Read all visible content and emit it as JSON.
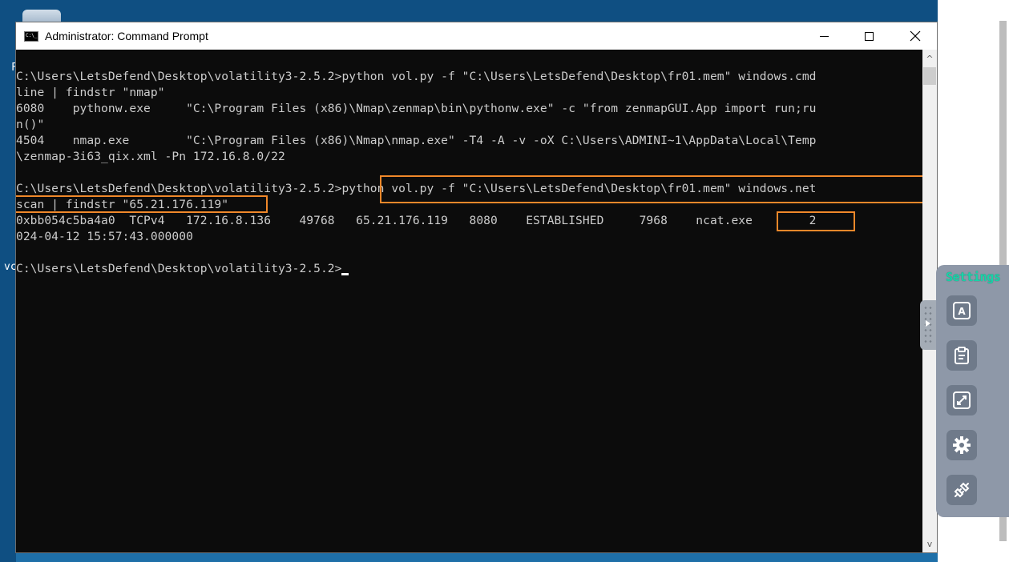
{
  "window": {
    "title": "Administrator: Command Prompt",
    "controls": {
      "minimize": "minimize",
      "maximize": "maximize",
      "close": "close"
    }
  },
  "desktop": {
    "left_fragment_1": "F",
    "left_fragment_2": "vc"
  },
  "console": {
    "lines": [
      "C:\\Users\\LetsDefend\\Desktop\\volatility3-2.5.2>python vol.py -f \"C:\\Users\\LetsDefend\\Desktop\\fr01.mem\" windows.cmd",
      "line | findstr \"nmap\"",
      "6080    pythonw.exe     \"C:\\Program Files (x86)\\Nmap\\zenmap\\bin\\pythonw.exe\" -c \"from zenmapGUI.App import run;ru",
      "n()\"",
      "4504    nmap.exe        \"C:\\Program Files (x86)\\Nmap\\nmap.exe\" -T4 -A -v -oX C:\\Users\\ADMINI~1\\AppData\\Local\\Temp",
      "\\zenmap-3i63_qix.xml -Pn 172.16.8.0/22",
      "",
      "C:\\Users\\LetsDefend\\Desktop\\volatility3-2.5.2>python vol.py -f \"C:\\Users\\LetsDefend\\Desktop\\fr01.mem\" windows.net",
      "scan | findstr \"65.21.176.119\"",
      "0xbb054c5ba4a0  TCPv4   172.16.8.136    49768   65.21.176.119   8080    ESTABLISHED     7968    ncat.exe        2",
      "024-04-12 15:57:43.000000",
      "",
      "C:\\Users\\LetsDefend\\Desktop\\volatility3-2.5.2>"
    ]
  },
  "settings": {
    "title": "Settings",
    "buttons": [
      {
        "icon": "font-a-icon"
      },
      {
        "icon": "clipboard-icon"
      },
      {
        "icon": "resize-icon"
      },
      {
        "icon": "gear-icon"
      },
      {
        "icon": "disconnect-icon"
      }
    ]
  },
  "colors": {
    "console_bg": "#0c0c0c",
    "console_text": "#cccccc",
    "highlight": "#f0882a",
    "settings_title": "#19d3a8"
  }
}
